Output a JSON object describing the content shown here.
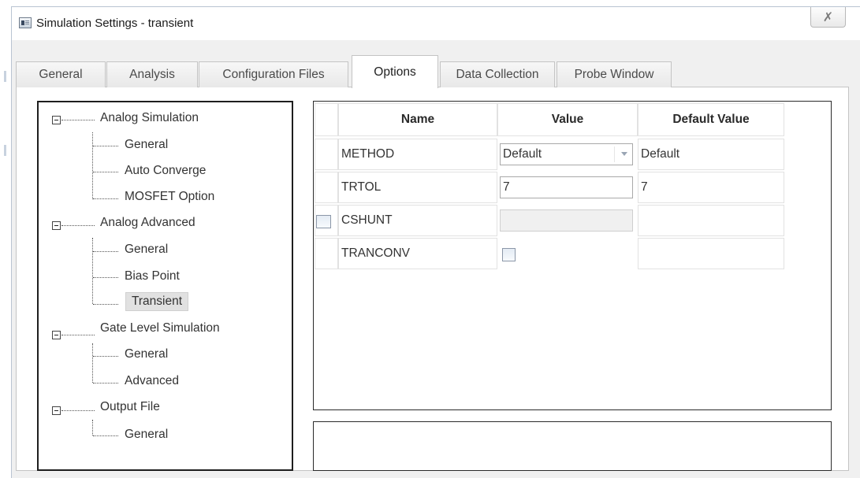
{
  "window": {
    "title": "Simulation Settings - transient",
    "close_glyph": "✗"
  },
  "tabs": [
    {
      "label": "General",
      "active": false
    },
    {
      "label": "Analysis",
      "active": false
    },
    {
      "label": "Configuration Files",
      "active": false
    },
    {
      "label": "Options",
      "active": true
    },
    {
      "label": "Data Collection",
      "active": false
    },
    {
      "label": "Probe Window",
      "active": false
    }
  ],
  "tree": {
    "groups": [
      {
        "label": "Analog Simulation",
        "children": [
          "General",
          "Auto Converge",
          "MOSFET Option"
        ]
      },
      {
        "label": "Analog Advanced",
        "children": [
          "General",
          "Bias Point",
          "Transient"
        ]
      },
      {
        "label": "Gate Level Simulation",
        "children": [
          "General",
          "Advanced"
        ]
      },
      {
        "label": "Output File",
        "children": [
          "General"
        ]
      }
    ],
    "selected": "Transient"
  },
  "grid": {
    "headers": {
      "name": "Name",
      "value": "Value",
      "default": "Default Value"
    },
    "rows": [
      {
        "name": "METHOD",
        "value": "Default",
        "default": "Default",
        "editor": "dropdown"
      },
      {
        "name": "TRTOL",
        "value": "7",
        "default": "7",
        "editor": "text"
      },
      {
        "name": "CSHUNT",
        "value": "",
        "default": "",
        "editor": "disabled",
        "row_checkbox": true
      },
      {
        "name": "TRANCONV",
        "value": "",
        "default": "",
        "editor": "checkbox"
      }
    ]
  },
  "colors": {
    "panel_border": "#1e1e1e",
    "selected_item_bg": "#e1e1e1",
    "window_bg": "#f0f0f0"
  }
}
